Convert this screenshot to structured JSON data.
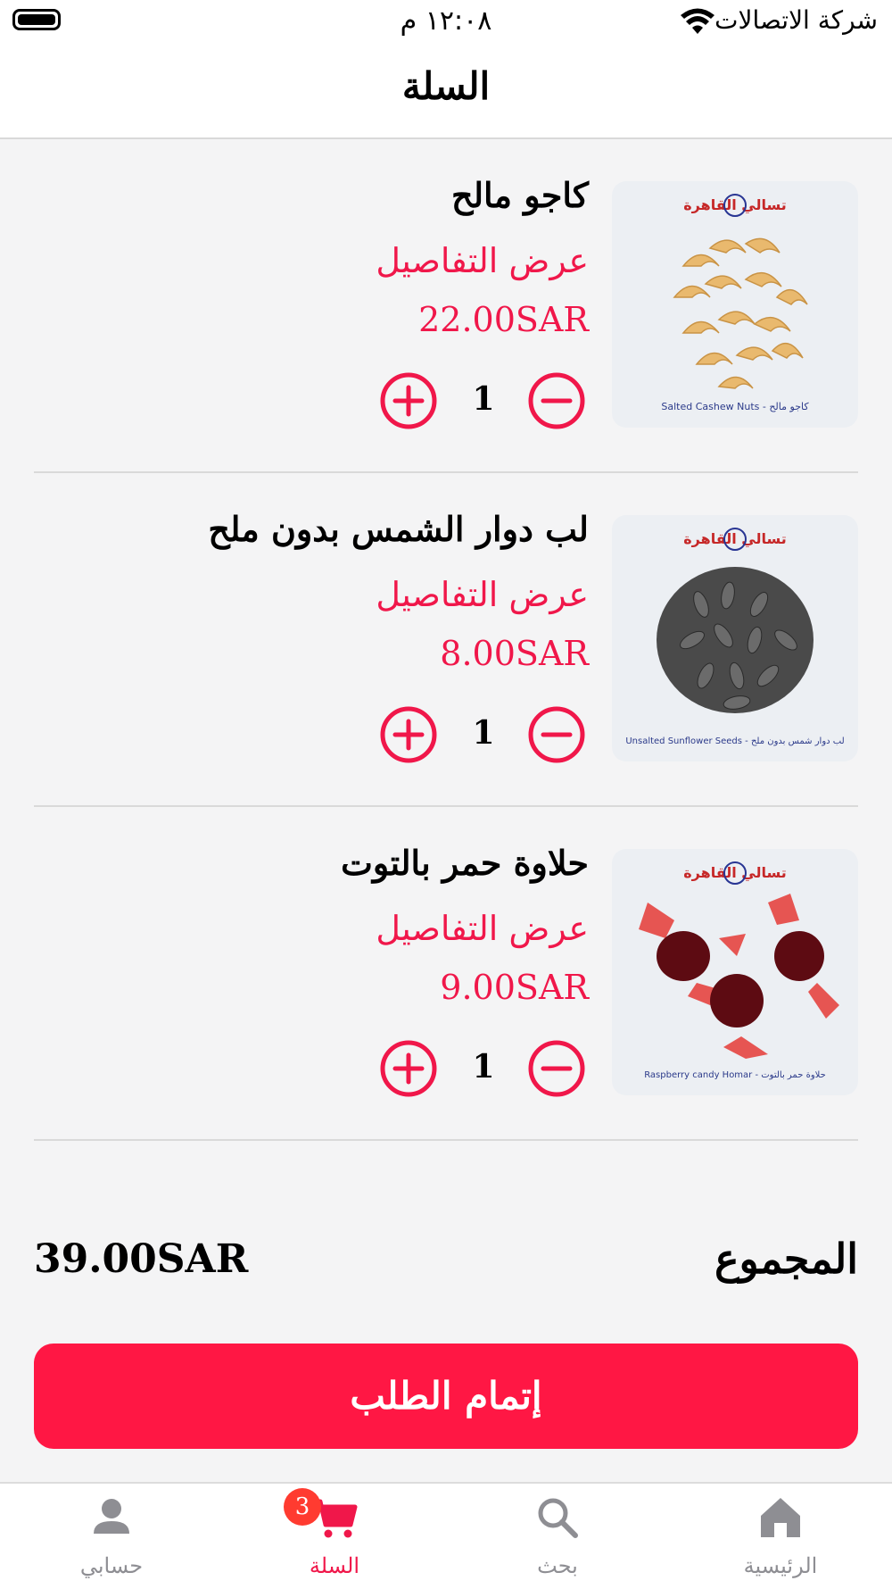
{
  "status_bar": {
    "time": "١٢:٠٨ م",
    "carrier": "شركة الاتصالات"
  },
  "header": {
    "title": "السلة"
  },
  "cart": {
    "items": [
      {
        "name": "كاجو مالح",
        "details_label": "عرض التفاصيل",
        "price": "22.00SAR",
        "quantity": "1",
        "image_caption": "Salted Cashew Nuts - كاجو مالح",
        "brand": "تسالي القاهرة"
      },
      {
        "name": "لب دوار الشمس بدون ملح",
        "details_label": "عرض التفاصيل",
        "price": "8.00SAR",
        "quantity": "1",
        "image_caption": "Unsalted Sunflower Seeds - لب دوار شمس بدون ملح",
        "brand": "تسالي القاهرة"
      },
      {
        "name": "حلاوة حمر بالتوت",
        "details_label": "عرض التفاصيل",
        "price": "9.00SAR",
        "quantity": "1",
        "image_caption": "Raspberry candy Homar - حلاوة حمر بالتوت",
        "brand": "تسالي القاهرة"
      }
    ]
  },
  "summary": {
    "total_label": "المجموع",
    "total_value": "39.00SAR"
  },
  "checkout": {
    "label": "إتمام الطلب"
  },
  "tab_bar": {
    "tabs": [
      {
        "label": "حسابي",
        "icon": "person-icon"
      },
      {
        "label": "السلة",
        "icon": "cart-icon",
        "badge": "3"
      },
      {
        "label": "بحث",
        "icon": "search-icon"
      },
      {
        "label": "الرئيسية",
        "icon": "home-icon"
      }
    ],
    "active_tab": "السلة"
  },
  "colors": {
    "accent": "#f0174a",
    "button": "#ff1744",
    "badge": "#ff3b30",
    "inactive_tab": "#8e8e93"
  }
}
